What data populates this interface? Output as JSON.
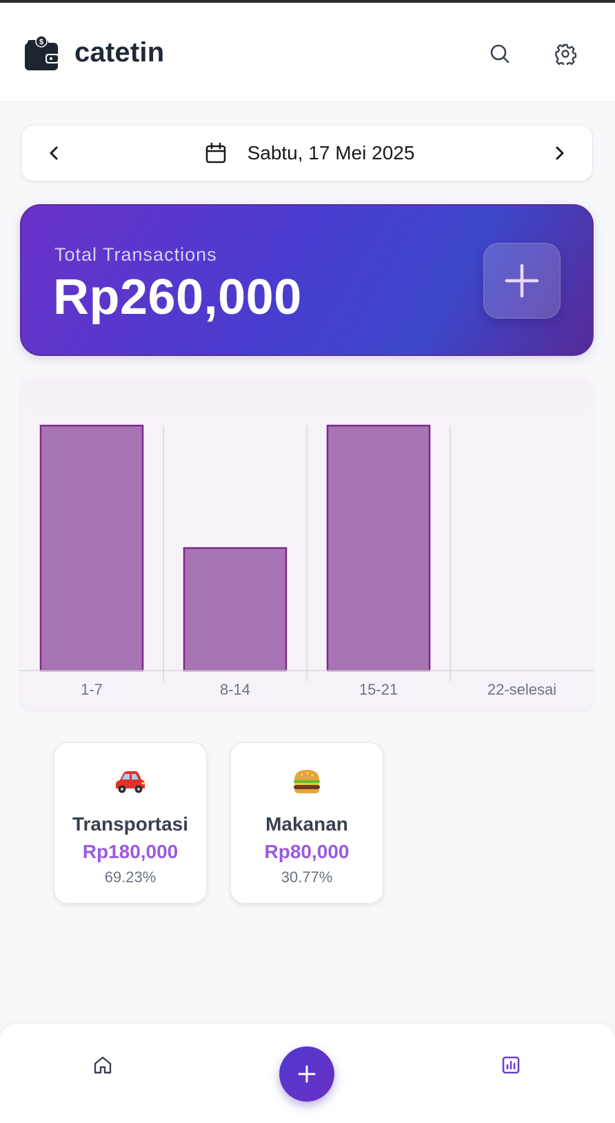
{
  "header": {
    "app_name": "catetin",
    "icons": {
      "logo": "wallet-icon",
      "search": "search-icon",
      "settings": "gear-icon"
    }
  },
  "date_nav": {
    "date_label": "Sabtu, 17 Mei 2025",
    "icons": {
      "prev": "chevron-left-icon",
      "calendar": "calendar-icon",
      "next": "chevron-right-icon"
    }
  },
  "summary": {
    "label": "Total Transactions",
    "total": "Rp260,000",
    "add_icon": "plus-icon"
  },
  "chart_data": {
    "type": "bar",
    "categories": [
      "1-7",
      "8-14",
      "15-21",
      "22-selesai"
    ],
    "values": [
      100,
      50,
      100,
      0
    ],
    "title": "",
    "xlabel": "",
    "ylabel": "",
    "ylim": [
      0,
      100
    ],
    "grid": true,
    "colors": {
      "bar_fill": "#a974b4",
      "bar_stroke": "#7a2a86",
      "grid": "#d9d6de",
      "background": "#f7f2fa"
    }
  },
  "categories": [
    {
      "name": "Transportasi",
      "amount": "Rp180,000",
      "percent": "69.23%",
      "icon": "car-icon"
    },
    {
      "name": "Makanan",
      "amount": "Rp80,000",
      "percent": "30.77%",
      "icon": "burger-icon"
    }
  ],
  "bottom_nav": {
    "home_icon": "home-icon",
    "add_icon": "plus-icon",
    "report_icon": "chart-icon"
  },
  "colors": {
    "accent_purple": "#6a32c9",
    "amount_purple": "#9b5ae0",
    "report_active": "#6b3fd1"
  }
}
